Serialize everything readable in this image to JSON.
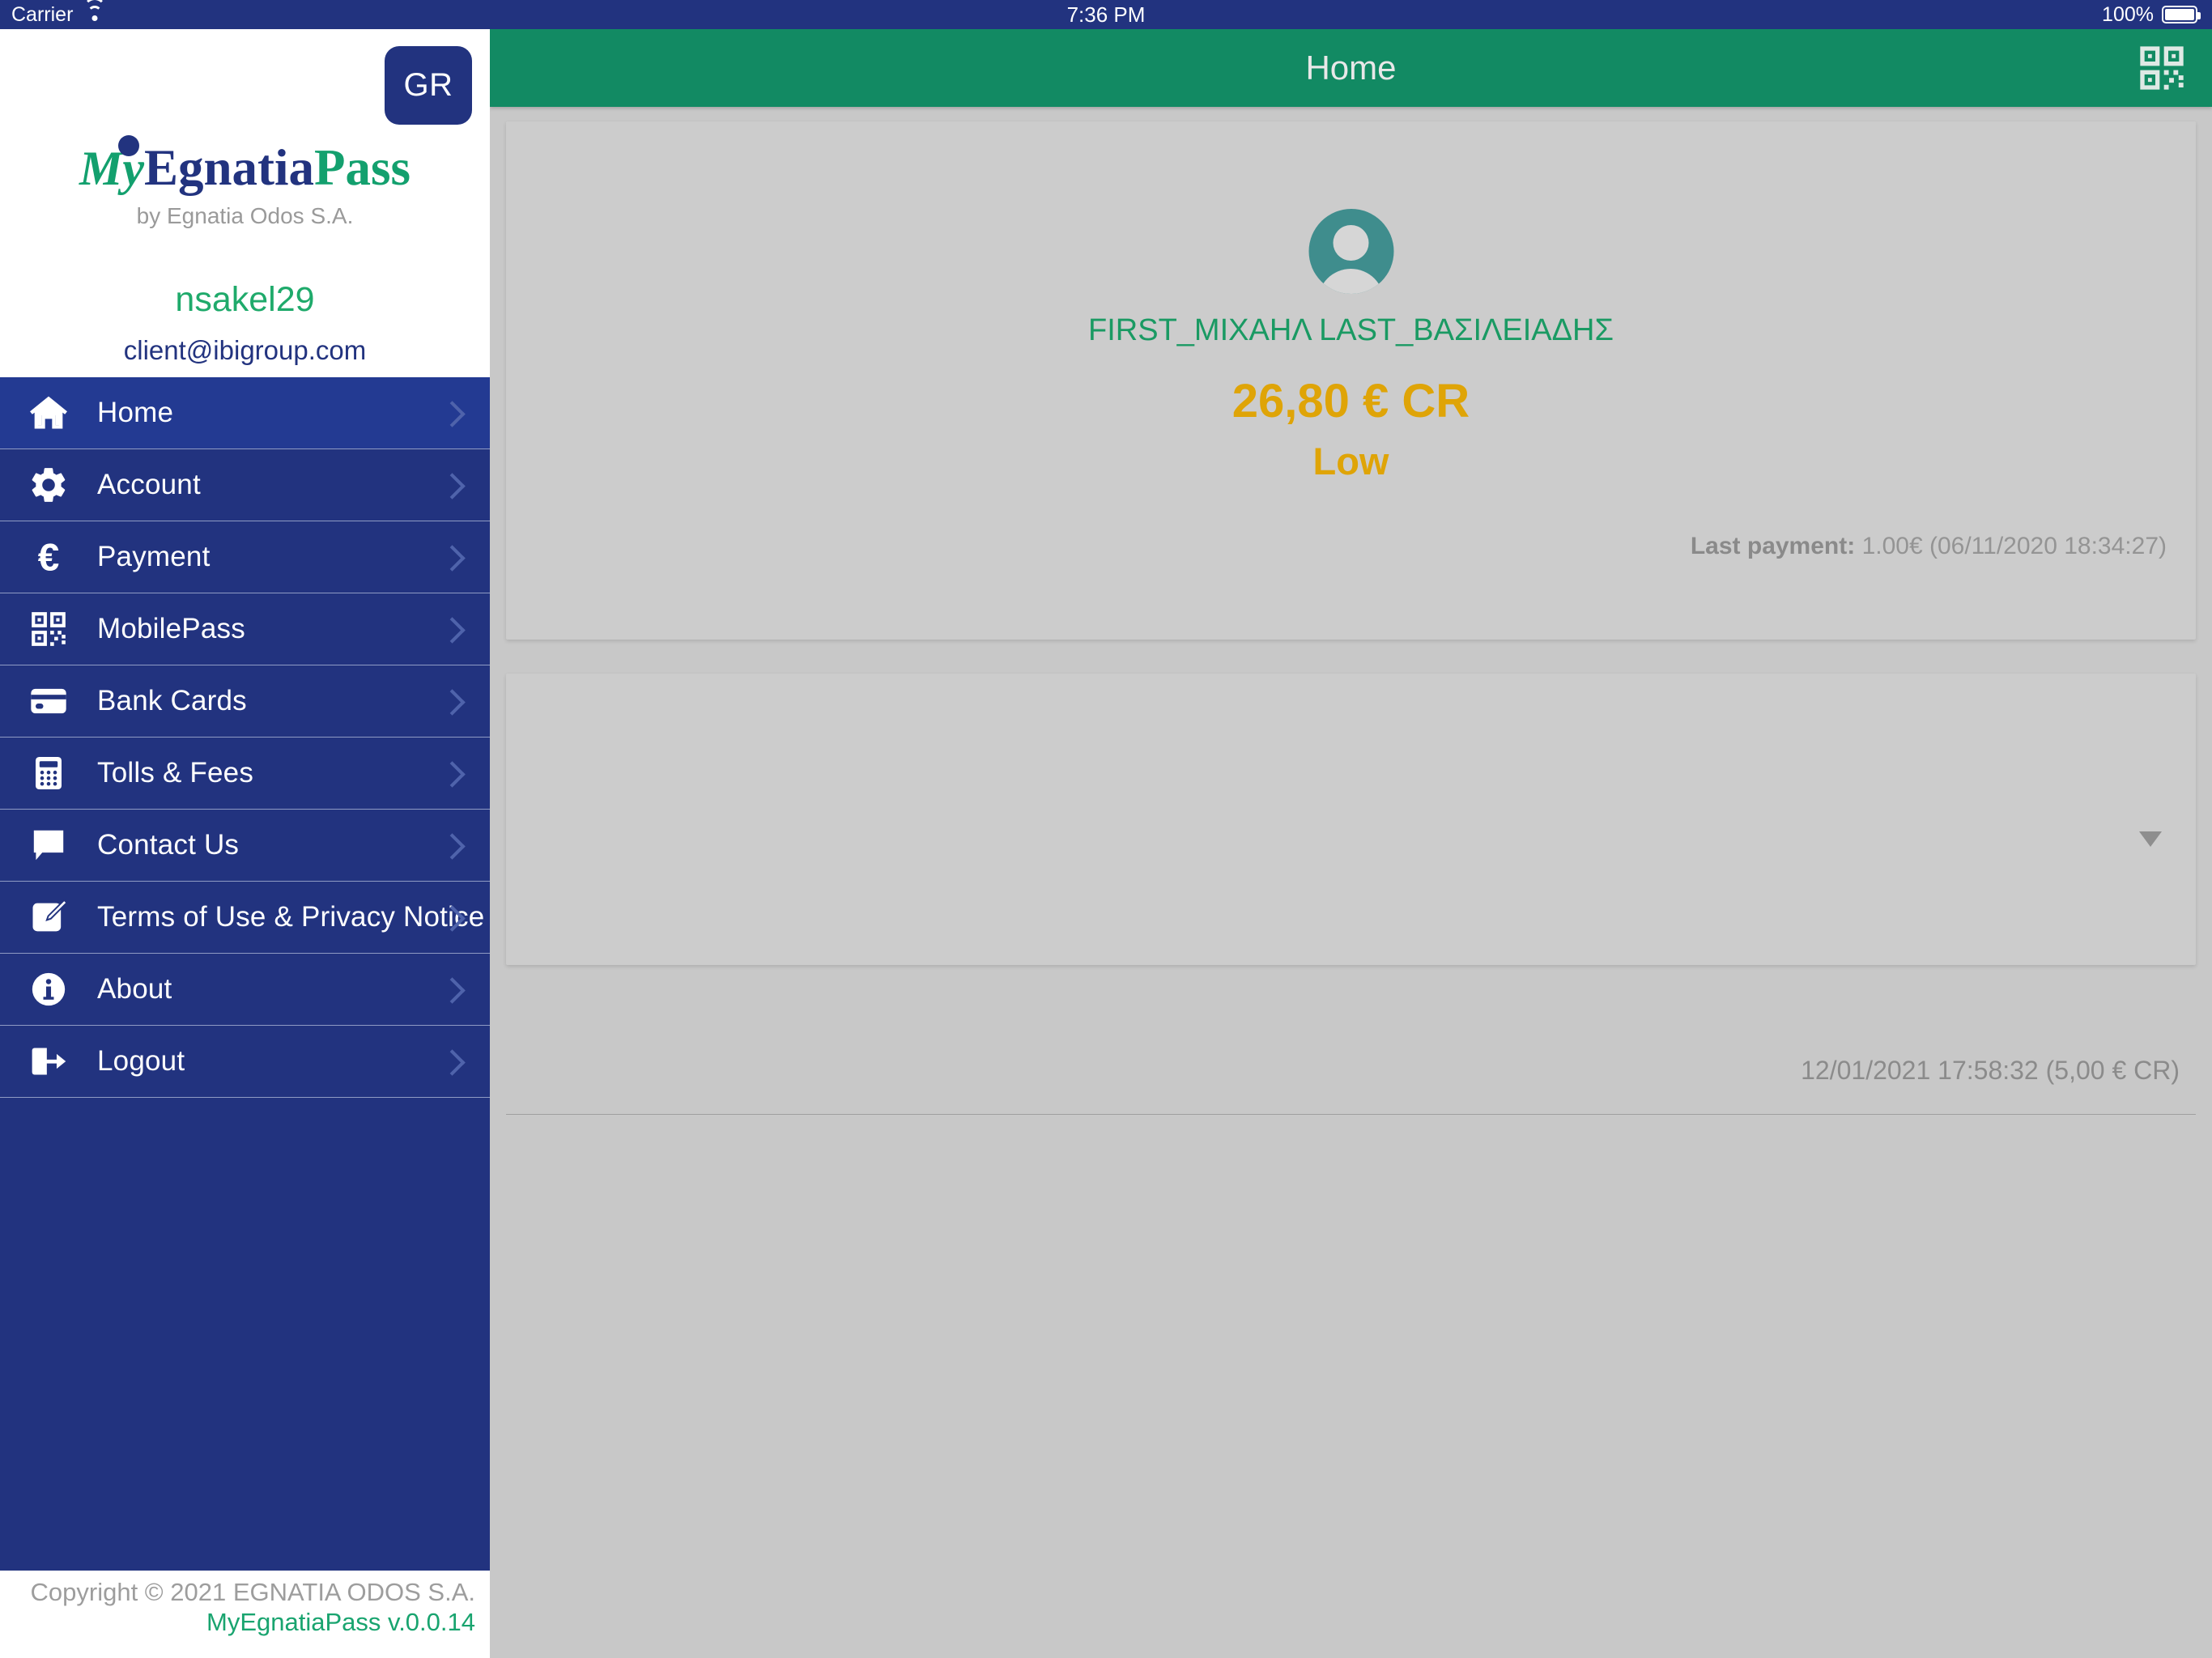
{
  "statusbar": {
    "carrier": "Carrier",
    "wifi_icon": "wifi-icon",
    "time": "7:36 PM",
    "battery_percent": "100%",
    "battery_icon": "battery-full-icon"
  },
  "sidebar": {
    "language_button": "GR",
    "logo": {
      "my": "My",
      "egnatia": "Egnatia",
      "pass": "Pass",
      "subtitle": "by Egnatia Odos S.A."
    },
    "user": {
      "username": "nsakel29",
      "email": "client@ibigroup.com"
    },
    "items": [
      {
        "label": "Home",
        "icon": "home-icon",
        "active": true
      },
      {
        "label": "Account",
        "icon": "gear-icon",
        "active": false
      },
      {
        "label": "Payment",
        "icon": "euro-icon",
        "active": false
      },
      {
        "label": "MobilePass",
        "icon": "qr-code-icon",
        "active": false
      },
      {
        "label": "Bank Cards",
        "icon": "credit-card-icon",
        "active": false
      },
      {
        "label": "Tolls & Fees",
        "icon": "calculator-icon",
        "active": false
      },
      {
        "label": "Contact Us",
        "icon": "chat-bubble-icon",
        "active": false
      },
      {
        "label": "Terms of Use & Privacy Notice",
        "icon": "edit-note-icon",
        "active": false
      },
      {
        "label": "About",
        "icon": "info-icon",
        "active": false
      },
      {
        "label": "Logout",
        "icon": "logout-icon",
        "active": false
      }
    ],
    "footer": {
      "copyright": "Copyright © 2021 EGNATIA ODOS S.A.",
      "version": "MyEgnatiaPass v.0.0.14"
    }
  },
  "appbar": {
    "title": "Home",
    "qr_icon": "qr-code-icon"
  },
  "balance_card": {
    "avatar_icon": "user-avatar-icon",
    "account_name": "FIRST_ΜΙΧΑΗΛ LAST_ΒΑΣΙΛΕΙΑΔΗΣ",
    "balance": "26,80 € CR",
    "balance_status": "Low",
    "last_payment_label": "Last payment:",
    "last_payment_value": "1.00€ (06/11/2020 18:34:27)"
  },
  "vehicle_card": {
    "dropdown_icon": "chevron-down-icon"
  },
  "transaction": {
    "text": "12/01/2021 17:58:32 (5,00 € CR)"
  },
  "colors": {
    "brand_blue": "#22337f",
    "brand_green": "#13a06e",
    "appbar_green": "#128a63",
    "balance_amber": "#dfa407",
    "page_bg": "#c8c8c8"
  }
}
